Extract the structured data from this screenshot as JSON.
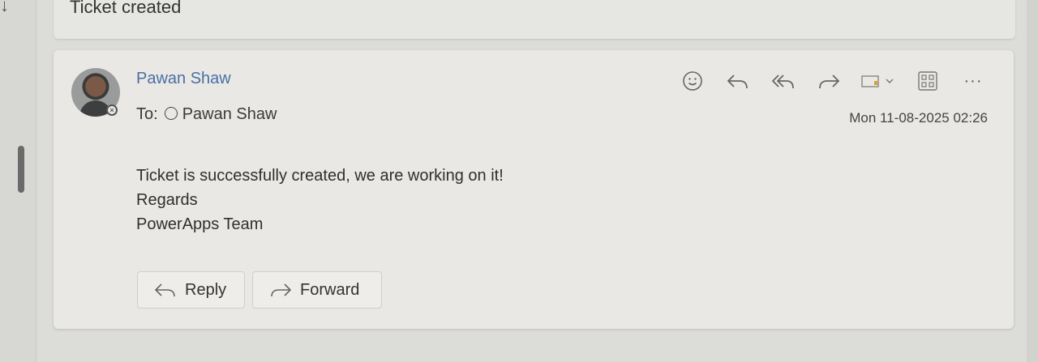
{
  "subject": "Ticket created",
  "message": {
    "sender": "Pawan Shaw",
    "to_label": "To:",
    "recipient": "Pawan Shaw",
    "timestamp": "Mon 11-08-2025 02:26",
    "body_lines": [
      "Ticket is successfully created, we are working on it!",
      "Regards",
      "PowerApps Team"
    ]
  },
  "toolbar": {
    "icons": [
      "emoji-icon",
      "reply-icon",
      "reply-all-icon",
      "forward-icon",
      "teams-share-icon",
      "apps-icon",
      "more-icon"
    ],
    "more_label": "···"
  },
  "actions": {
    "reply_label": "Reply",
    "forward_label": "Forward"
  },
  "colors": {
    "sender": "#4a6fa5",
    "background": "#dcdcd8",
    "card": "#e9e8e4"
  }
}
